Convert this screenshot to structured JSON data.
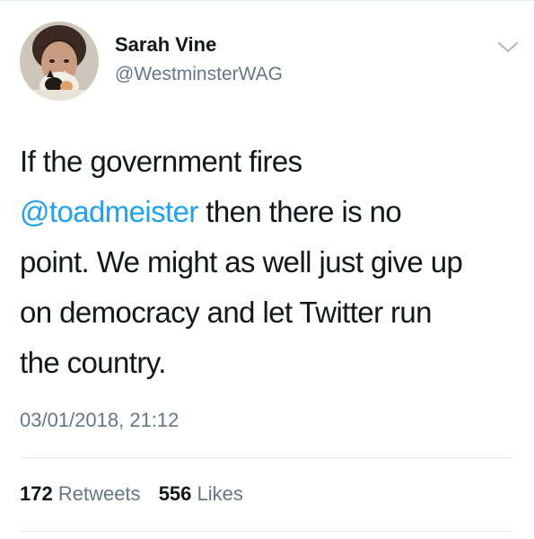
{
  "tweet": {
    "author": {
      "display_name": "Sarah Vine",
      "handle": "@WestminsterWAG",
      "avatar_icon": "profile-photo"
    },
    "menu_icon": "chevron-down-icon",
    "text_lines": [
      {
        "text": "If the government fires"
      },
      {
        "mention": "@toadmeister",
        "text": " then there is no"
      },
      {
        "text": "point. We might as well just give up"
      },
      {
        "text": "on democracy and let Twitter run"
      },
      {
        "text": "the country."
      }
    ],
    "timestamp": "03/01/2018, 21:12",
    "stats": {
      "retweets_count": "172",
      "retweets_label": "Retweets",
      "likes_count": "556",
      "likes_label": "Likes"
    },
    "colors": {
      "text": "#14171a",
      "secondary": "#657786",
      "mention": "#1da1f2",
      "divider": "#e6ecf0"
    }
  }
}
